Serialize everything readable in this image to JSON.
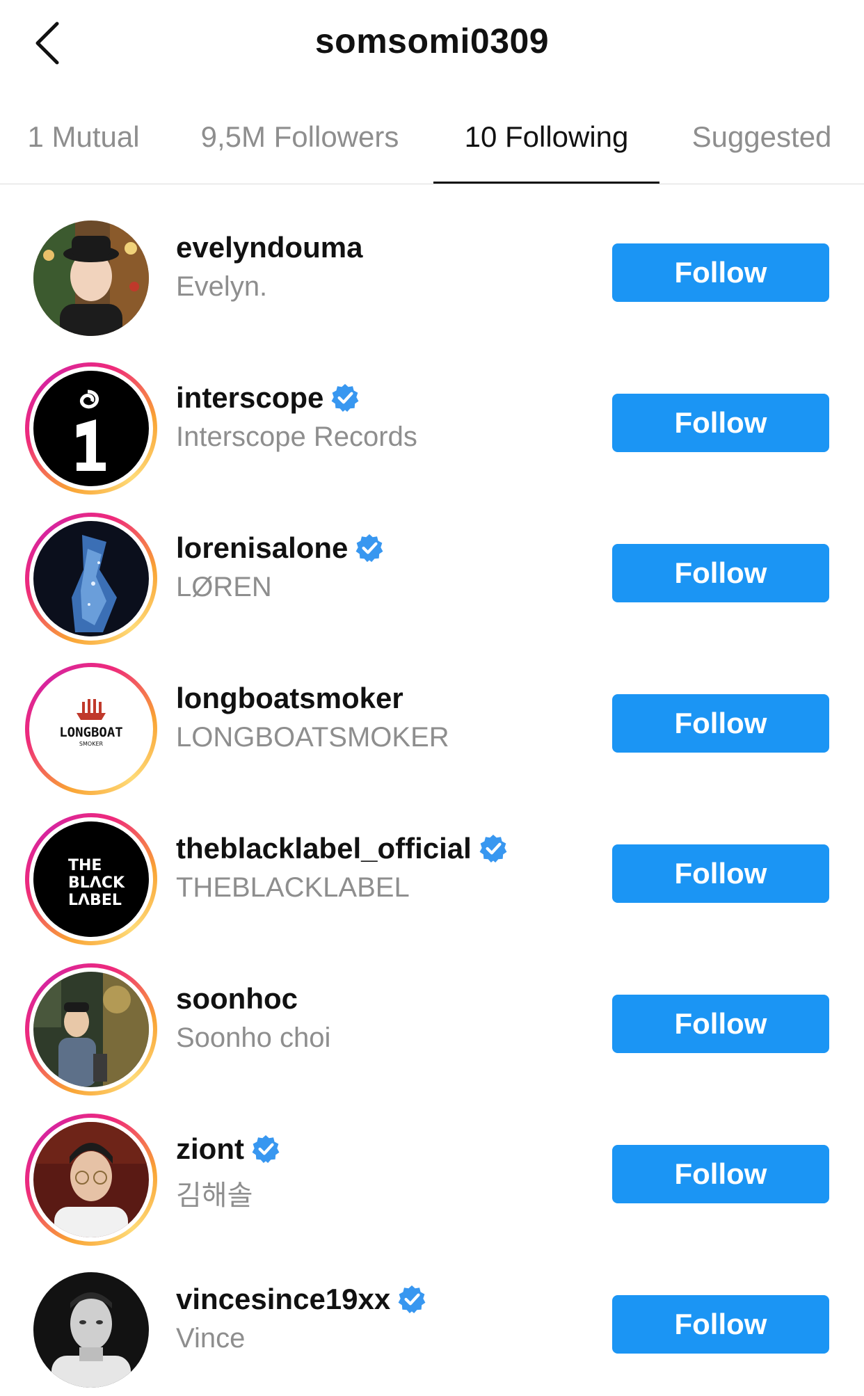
{
  "header": {
    "title": "somsomi0309"
  },
  "tabs": [
    {
      "label": "1 Mutual",
      "active": false
    },
    {
      "label": "9,5M Followers",
      "active": false
    },
    {
      "label": "10 Following",
      "active": true
    },
    {
      "label": "Suggested",
      "active": false
    }
  ],
  "accounts": [
    {
      "username": "evelyndouma",
      "fullname": "Evelyn.",
      "verified": false,
      "story_ring": false,
      "button_label": "Follow"
    },
    {
      "username": "interscope",
      "fullname": "Interscope Records",
      "verified": true,
      "story_ring": true,
      "button_label": "Follow"
    },
    {
      "username": "lorenisalone",
      "fullname": "LØREN",
      "verified": true,
      "story_ring": true,
      "button_label": "Follow"
    },
    {
      "username": "longboatsmoker",
      "fullname": "LONGBOATSMOKER",
      "verified": false,
      "story_ring": true,
      "button_label": "Follow",
      "logo_text": "LONGBOAT",
      "logo_subtext": "SMOKER"
    },
    {
      "username": "theblacklabel_official",
      "fullname": "THEBLACKLABEL",
      "verified": true,
      "story_ring": true,
      "button_label": "Follow",
      "logo_lines": [
        "THE",
        "BLΛCK",
        "LΛBEL"
      ]
    },
    {
      "username": "soonhoc",
      "fullname": "Soonho choi",
      "verified": false,
      "story_ring": true,
      "button_label": "Follow"
    },
    {
      "username": "ziont",
      "fullname": "김해솔",
      "verified": true,
      "story_ring": true,
      "button_label": "Follow"
    },
    {
      "username": "vincesince19xx",
      "fullname": "Vince",
      "verified": true,
      "story_ring": false,
      "button_label": "Follow"
    }
  ],
  "colors": {
    "follow_button": "#1b95f4",
    "verified_badge": "#3897f0",
    "secondary_text": "#8e8e8e"
  },
  "icons": {
    "back": "chevron-left-icon",
    "verified": "verified-badge-icon"
  }
}
